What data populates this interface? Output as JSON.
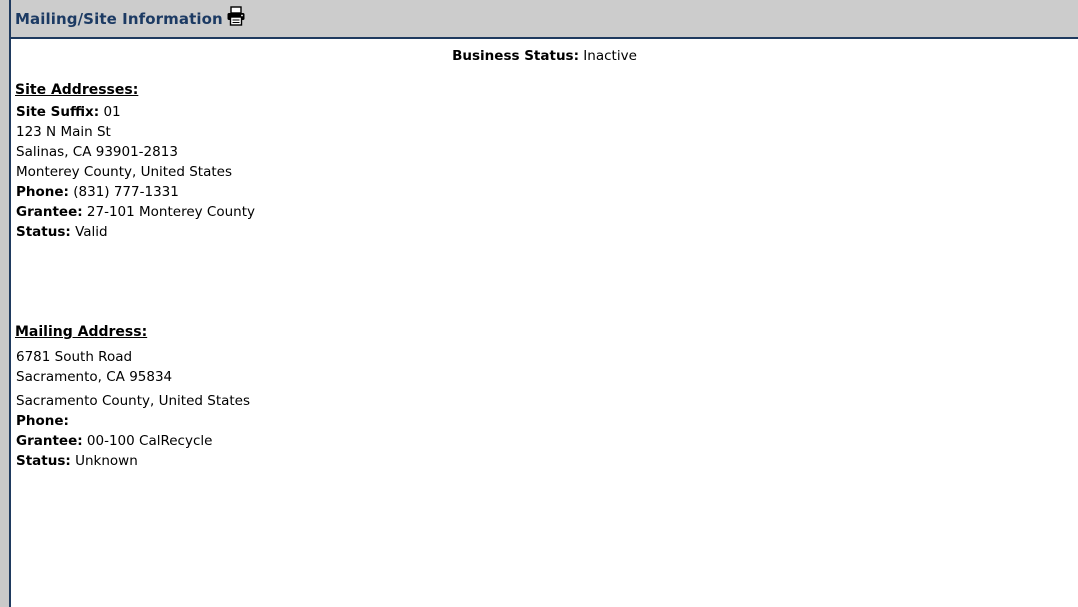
{
  "panel": {
    "title": "Mailing/Site Information",
    "print_icon": "printer-icon"
  },
  "business_status": {
    "label": "Business Status:",
    "value": "Inactive"
  },
  "site": {
    "heading": "Site Addresses:",
    "suffix_label": "Site Suffix:",
    "suffix_value": "01",
    "street": "123 N Main St",
    "city_line": "Salinas, CA 93901-2813",
    "county_line": "Monterey County, United States",
    "phone_label": "Phone:",
    "phone_value": "(831) 777-1331",
    "grantee_label": "Grantee:",
    "grantee_value": "27-101 Monterey County",
    "status_label": "Status:",
    "status_value": "Valid"
  },
  "mailing": {
    "heading": "Mailing Address:",
    "street": "6781 South Road",
    "city_line": "Sacramento, CA 95834",
    "county_line": "Sacramento County, United States",
    "phone_label": "Phone:",
    "phone_value": "",
    "grantee_label": "Grantee:",
    "grantee_value": "00-100 CalRecycle",
    "status_label": "Status:",
    "status_value": "Unknown"
  },
  "colors": {
    "header_bg": "#cccccc",
    "header_text": "#1c3a63",
    "border": "#1f3a5f"
  }
}
